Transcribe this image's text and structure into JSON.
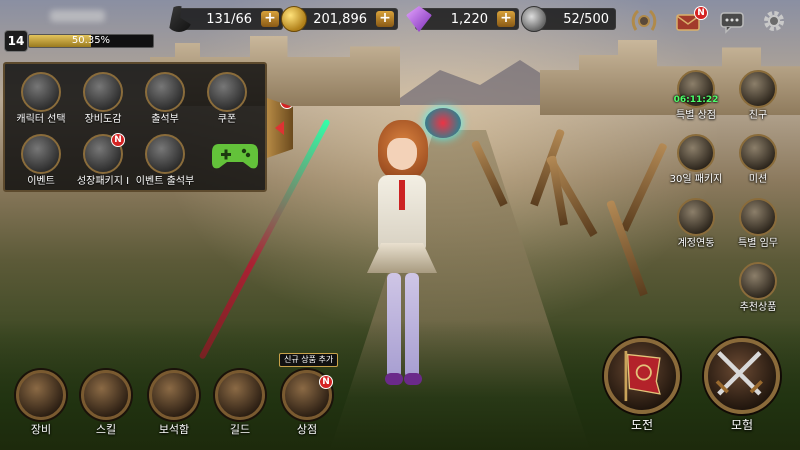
{
  "player": {
    "level": "14",
    "exp_percent": "50.35%",
    "exp_fraction": 0.5035
  },
  "resources": {
    "stamina": "131/66",
    "gold": "201,896",
    "gems": "1,220",
    "capacity": "52/500"
  },
  "top_icons": {
    "guild_icon": "laurel-icon",
    "mail_badge": "N",
    "chat_icon": "chat-icon",
    "settings_icon": "gear-icon"
  },
  "menu_panel": {
    "items": [
      {
        "label": "캐릭터 선택",
        "icon": "helmet-icon"
      },
      {
        "label": "장비도감",
        "icon": "book-icon"
      },
      {
        "label": "출석부",
        "icon": "calendar-icon"
      },
      {
        "label": "쿠폰",
        "icon": "coupon-icon"
      },
      {
        "label": "이벤트",
        "icon": "horn-icon"
      },
      {
        "label": "성장패키지 I",
        "icon": "package-icon",
        "badge": "N"
      },
      {
        "label": "이벤트 출석부",
        "icon": "event-icon"
      },
      {
        "label": "",
        "icon": "gamepad-icon"
      }
    ],
    "tab_badge": "N"
  },
  "side_menu": {
    "items": [
      {
        "label": "특별 상점",
        "timer": "06:11:22"
      },
      {
        "label": "친구"
      },
      {
        "label": "30일 패키지"
      },
      {
        "label": "미션"
      },
      {
        "label": "계정연동"
      },
      {
        "label": "특별 임무"
      },
      {
        "label": "추천상품"
      }
    ]
  },
  "bottom_bar": {
    "items": [
      {
        "label": "장비"
      },
      {
        "label": "스킬"
      },
      {
        "label": "보석함"
      },
      {
        "label": "길드"
      },
      {
        "label": "상점",
        "badge": "N"
      }
    ],
    "shop_tag": "신규 상품 추가",
    "challenge_label": "도전",
    "adventure_label": "모험"
  },
  "colors": {
    "accent_gold": "#d8a23b",
    "badge_red": "#d42323",
    "timer_green": "#4dff6a"
  }
}
